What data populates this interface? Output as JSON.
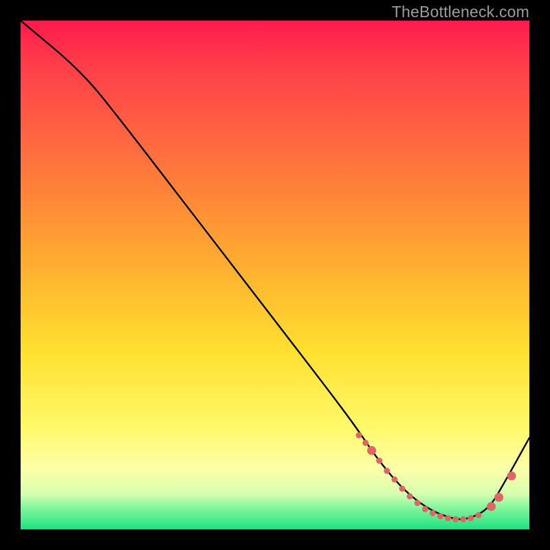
{
  "watermark": "TheBottleneck.com",
  "chart_data": {
    "type": "line",
    "title": "",
    "xlabel": "",
    "ylabel": "",
    "xlim": [
      0,
      100
    ],
    "ylim": [
      0,
      100
    ],
    "curve": {
      "name": "bottleneck-curve",
      "x": [
        0,
        12,
        20,
        30,
        40,
        50,
        60,
        66,
        70,
        75,
        80,
        85,
        88,
        92,
        95,
        100
      ],
      "y": [
        100,
        90,
        80,
        67,
        54,
        41,
        28,
        20,
        14,
        8,
        4,
        2,
        2,
        4,
        9,
        18
      ]
    },
    "markers": {
      "name": "highlight-points",
      "color": "#e06666",
      "radius_small": 4.5,
      "radius_large": 6.5,
      "points": [
        {
          "x": 66.5,
          "y": 18.5,
          "r": "small"
        },
        {
          "x": 67.8,
          "y": 17.0,
          "r": "small"
        },
        {
          "x": 69.0,
          "y": 15.5,
          "r": "large"
        },
        {
          "x": 70.5,
          "y": 13.5,
          "r": "small"
        },
        {
          "x": 72.0,
          "y": 11.5,
          "r": "small"
        },
        {
          "x": 73.5,
          "y": 9.8,
          "r": "small"
        },
        {
          "x": 75.0,
          "y": 8.0,
          "r": "small"
        },
        {
          "x": 76.5,
          "y": 6.5,
          "r": "small"
        },
        {
          "x": 78.0,
          "y": 5.2,
          "r": "small"
        },
        {
          "x": 79.5,
          "y": 4.0,
          "r": "small"
        },
        {
          "x": 81.0,
          "y": 3.2,
          "r": "small"
        },
        {
          "x": 82.5,
          "y": 2.6,
          "r": "small"
        },
        {
          "x": 84.0,
          "y": 2.2,
          "r": "small"
        },
        {
          "x": 85.5,
          "y": 2.0,
          "r": "small"
        },
        {
          "x": 87.0,
          "y": 2.0,
          "r": "small"
        },
        {
          "x": 88.5,
          "y": 2.2,
          "r": "small"
        },
        {
          "x": 90.0,
          "y": 2.8,
          "r": "small"
        },
        {
          "x": 92.5,
          "y": 4.5,
          "r": "large"
        },
        {
          "x": 94.0,
          "y": 6.3,
          "r": "large"
        },
        {
          "x": 96.5,
          "y": 10.5,
          "r": "large"
        }
      ]
    }
  }
}
